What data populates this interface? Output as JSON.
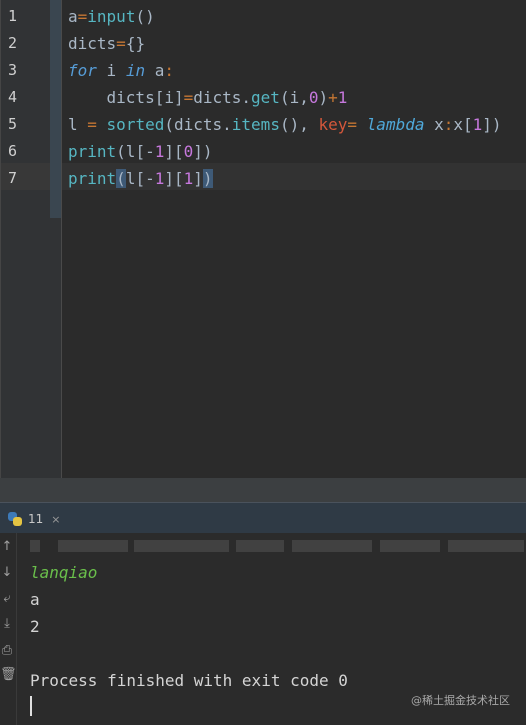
{
  "editor": {
    "line_numbers": [
      "1",
      "2",
      "3",
      "4",
      "5",
      "6",
      "7"
    ],
    "lines": [
      "a=input()",
      "dicts={}",
      "for i in a:",
      "    dicts[i]=dicts.get(i,0)+1",
      "l = sorted(dicts.items(), key= lambda x:x[1])",
      "print(l[-1][0])",
      "print(l[-1][1])"
    ],
    "current_line": 7
  },
  "run_panel": {
    "tab_label": "11",
    "tab_close": "×",
    "output": {
      "input_echo": "lanqiao",
      "result_1": "a",
      "result_2": "2",
      "finish": "Process finished with exit code 0"
    }
  },
  "toolbar_icons": [
    "up-arrow-icon",
    "down-arrow-icon",
    "soft-wrap-icon",
    "scroll-to-end-icon",
    "print-icon",
    "trash-icon"
  ],
  "watermark": "@稀土掘金技术社区"
}
